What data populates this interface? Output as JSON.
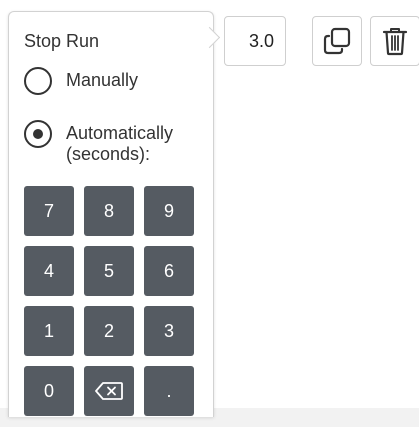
{
  "popover": {
    "title": "Stop Run",
    "options": [
      {
        "label": "Manually",
        "selected": false
      },
      {
        "label": "Automatically",
        "sublabel": "(seconds):",
        "selected": true
      }
    ],
    "keypad": {
      "keys": [
        "7",
        "8",
        "9",
        "4",
        "5",
        "6",
        "1",
        "2",
        "3",
        "0",
        "backspace",
        "."
      ]
    }
  },
  "toolbar": {
    "value": "3.0",
    "duplicate_icon": "duplicate-icon",
    "delete_icon": "trash-icon"
  },
  "colors": {
    "key_background": "#555b62",
    "key_text": "#ffffff",
    "text": "#333333",
    "border": "#cfcfcf"
  }
}
